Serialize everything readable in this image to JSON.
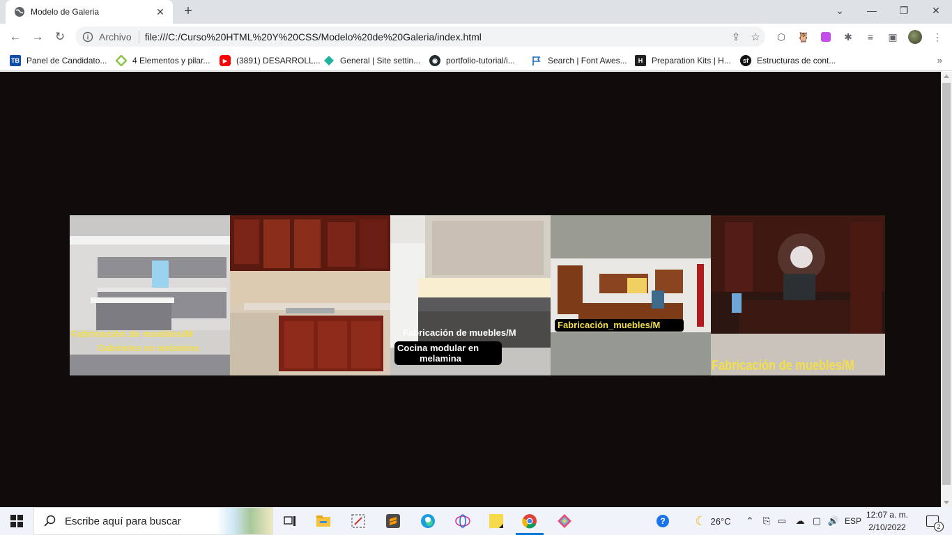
{
  "browser": {
    "tab_title": "Modelo de Galeria",
    "omnibox_scheme": "Archivo",
    "url": "file:///C:/Curso%20HTML%20Y%20CSS/Modelo%20de%20Galeria/index.html",
    "bookmarks": [
      {
        "label": "Panel de Candidato...",
        "icon": "tb-icon",
        "color": "#0f4fa8"
      },
      {
        "label": "4 Elementos y pilar...",
        "icon": "diamond-outline-icon",
        "color": "#8bc34a"
      },
      {
        "label": "(3891) DESARROLL...",
        "icon": "youtube-icon",
        "color": "#ff0000"
      },
      {
        "label": "General | Site settin...",
        "icon": "netlify-icon",
        "color": "#20b2a0"
      },
      {
        "label": "portfolio-tutorial/i...",
        "icon": "github-icon",
        "color": "#24292e"
      },
      {
        "label": "Search | Font Awes...",
        "icon": "flag-icon",
        "color": "#146ebe"
      },
      {
        "label": "Preparation Kits | H...",
        "icon": "hackerrank-icon",
        "color": "#1f1f1f"
      },
      {
        "label": "Estructuras de cont...",
        "icon": "symfony-icon",
        "color": "#111111"
      }
    ]
  },
  "gallery": {
    "images": [
      {
        "name": "kitchen-gray-cabinets",
        "captions": [
          "Fabricación de muebles/M",
          "Gabinetes en melamina"
        ]
      },
      {
        "name": "kitchen-mahogany-cabinets",
        "captions": []
      },
      {
        "name": "kitchen-modular-light-wood",
        "captions": [
          "Fabricación de muebles/M",
          "Cocina modular en",
          "melamina"
        ]
      },
      {
        "name": "kitchen-wood-island",
        "captions": [
          "Fabricación_muebles/M"
        ]
      },
      {
        "name": "kitchen-dark-wood-fridge",
        "captions": [
          "Fabricación de muebles/M"
        ]
      }
    ]
  },
  "taskbar": {
    "search_placeholder": "Escribe aquí para buscar",
    "weather": "26°C",
    "language": "ESP",
    "time": "12:07 a. m.",
    "date": "2/10/2022",
    "notifications": "2"
  }
}
